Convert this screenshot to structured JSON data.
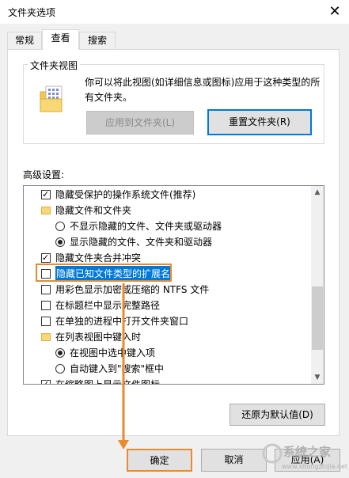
{
  "window": {
    "title": "文件夹选项",
    "close_glyph": "✕"
  },
  "tabs": [
    {
      "label": "常规"
    },
    {
      "label": "查看"
    },
    {
      "label": "搜索"
    }
  ],
  "folder_view": {
    "group_label": "文件夹视图",
    "description": "你可以将此视图(如详细信息或图标)应用于这种类型的所有文件夹。",
    "apply_button": "应用到文件夹(L)",
    "reset_button": "重置文件夹(R)"
  },
  "advanced": {
    "label": "高级设置:",
    "items": [
      {
        "type": "checkbox",
        "checked": true,
        "label": "隐藏受保护的操作系统文件(推荐)"
      },
      {
        "type": "folder",
        "label": "隐藏文件和文件夹"
      },
      {
        "type": "radio",
        "checked": false,
        "label": "不显示隐藏的文件、文件夹或驱动器"
      },
      {
        "type": "radio",
        "checked": true,
        "label": "显示隐藏的文件、文件夹和驱动器"
      },
      {
        "type": "checkbox",
        "checked": true,
        "label": "隐藏文件夹合并冲突"
      },
      {
        "type": "checkbox",
        "checked": false,
        "label": "隐藏已知文件类型的扩展名"
      },
      {
        "type": "checkbox",
        "checked": false,
        "label": "用彩色显示加密或压缩的 NTFS 文件"
      },
      {
        "type": "checkbox",
        "checked": false,
        "label": "在标题栏中显示完整路径"
      },
      {
        "type": "checkbox",
        "checked": false,
        "label": "在单独的进程中打开文件夹窗口"
      },
      {
        "type": "folder",
        "label": "在列表视图中键入时"
      },
      {
        "type": "radio",
        "checked": true,
        "label": "在视图中选中键入项"
      },
      {
        "type": "radio",
        "checked": false,
        "label": "自动键入到\"搜索\"框中"
      },
      {
        "type": "checkbox",
        "checked": true,
        "label": "在缩略图上显示文件图标"
      }
    ],
    "restore_button": "还原为默认值(D)"
  },
  "footer": {
    "ok_button": "确定",
    "cancel_button": "取消",
    "apply_button": "应用(A)"
  },
  "watermark": {
    "text": "系统之家",
    "url": "www.xitongzhijia.net"
  },
  "colors": {
    "highlight": "#e88a2e",
    "focus": "#0078d7"
  }
}
